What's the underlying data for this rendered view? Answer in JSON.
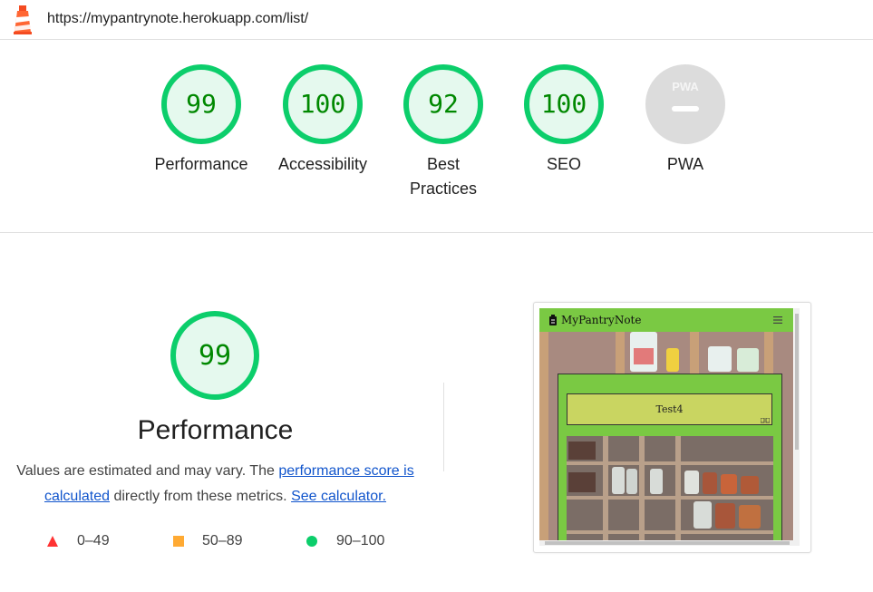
{
  "browser": {
    "url": "https://mypantrynote.herokuapp.com/list/"
  },
  "categories": [
    {
      "id": "performance",
      "score": 99,
      "label": "Performance"
    },
    {
      "id": "accessibility",
      "score": 100,
      "label": "Accessibility"
    },
    {
      "id": "best-practices",
      "score": 92,
      "label_line1": "Best",
      "label_line2": "Practices"
    },
    {
      "id": "seo",
      "score": 100,
      "label": "SEO"
    },
    {
      "id": "pwa",
      "label": "PWA",
      "badge_text": "PWA"
    }
  ],
  "performance": {
    "score": 99,
    "title": "Performance",
    "desc_before": "Values are estimated and may vary. The ",
    "link_score": "performance score is calculated",
    "desc_middle": " directly from these metrics. ",
    "link_calc": "See calculator."
  },
  "legend": [
    {
      "range": "0–49",
      "color": "#ff3333",
      "icon": "triangle-icon"
    },
    {
      "range": "50–89",
      "color": "#ffaa33",
      "icon": "square-icon"
    },
    {
      "range": "90–100",
      "color": "#0cce6b",
      "icon": "circle-icon"
    }
  ],
  "colors": {
    "pass": "#0cce6b",
    "pass_fill": "#e5f9ee",
    "pass_text": "#008800",
    "na": "#dcdcdc"
  },
  "screenshot": {
    "brand": "MyPantryNote",
    "item": "Test4"
  }
}
